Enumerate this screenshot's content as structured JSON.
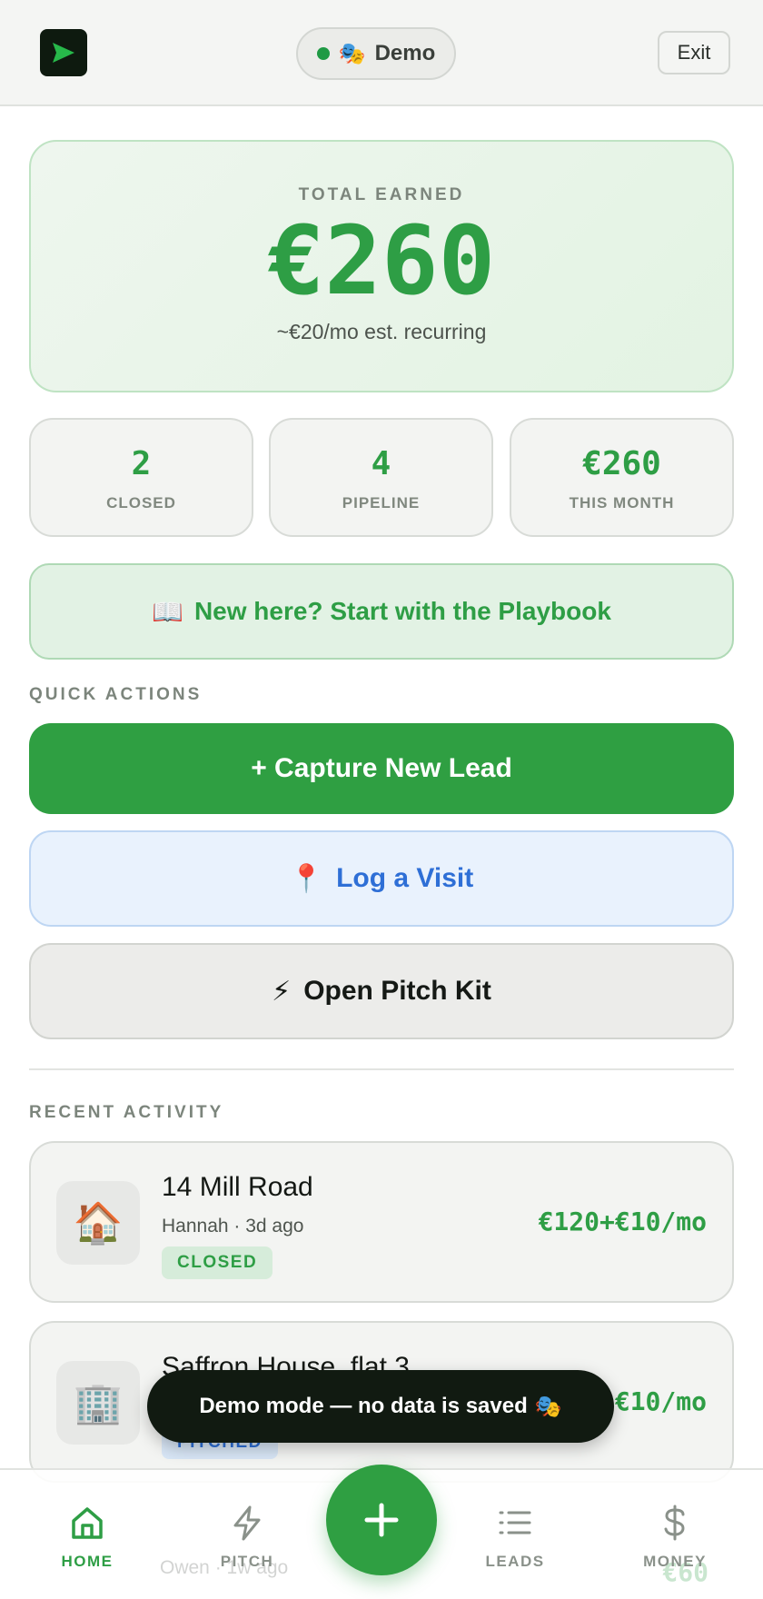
{
  "header": {
    "mode_label": "Demo",
    "mode_emoji": "🎭",
    "exit_label": "Exit"
  },
  "hero": {
    "label": "TOTAL EARNED",
    "value": "€260",
    "subtitle": "~€20/mo est. recurring"
  },
  "stats": [
    {
      "value": "2",
      "label": "CLOSED"
    },
    {
      "value": "4",
      "label": "PIPELINE"
    },
    {
      "value": "€260",
      "label": "THIS MONTH"
    }
  ],
  "playbook": {
    "emoji": "📖",
    "label": "New here? Start with the Playbook"
  },
  "quick_actions": {
    "title": "QUICK ACTIONS",
    "capture": "+ Capture New Lead",
    "visit_emoji": "📍",
    "visit": "Log a Visit",
    "pitch_emoji": "⚡",
    "pitch": "Open Pitch Kit"
  },
  "recent": {
    "title": "RECENT ACTIVITY",
    "items": [
      {
        "icon": "🏠",
        "title": "14 Mill Road",
        "meta": "Hannah · 3d ago",
        "badge": "CLOSED",
        "amount": "€120+€10/mo"
      },
      {
        "icon": "🏢",
        "title": "Saffron House, flat 3",
        "meta": "",
        "badge": "PITCHED",
        "amount": "€10/mo"
      }
    ],
    "ghost": {
      "meta": "Owen · 1w ago",
      "amount": "€60"
    }
  },
  "toast": {
    "text": "Demo mode — no data is saved",
    "emoji": "🎭"
  },
  "nav": {
    "home": "HOME",
    "pitch": "PITCH",
    "leads": "LEADS",
    "money": "MONEY"
  },
  "colors": {
    "accent": "#2f9f42",
    "blue": "#2e6fd6",
    "dark": "#0e1a0f"
  }
}
